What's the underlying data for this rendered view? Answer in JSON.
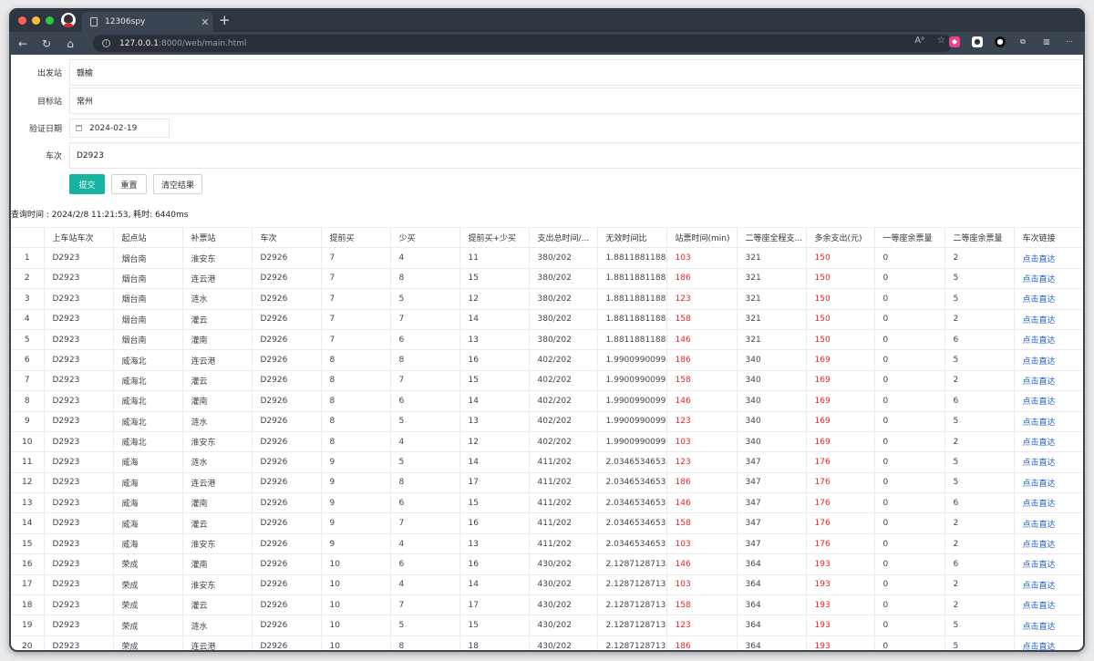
{
  "browser": {
    "tab_title": "12306spy",
    "url_host": "127.0.0.1",
    "url_path": ":8000/web/main.html"
  },
  "form": {
    "from_label": "出发站",
    "from_value": "赣榆",
    "to_label": "目标站",
    "to_value": "常州",
    "date_label": "验证日期",
    "date_value": "2024-02-19",
    "train_label": "车次",
    "train_value": "D2923",
    "submit_label": "提交",
    "reset_label": "重置",
    "clear_label": "清空结果"
  },
  "query_meta": "查询时间 : 2024/2/8 11:21:53, 耗时: 6440ms",
  "table": {
    "headers": [
      "",
      "上车站车次",
      "起点站",
      "补票站",
      "车次",
      "提前买",
      "少买",
      "提前买+少买",
      "支出总时间/...",
      "无效时间比",
      "站票时间(min)",
      "二等座全程支...",
      "多余支出(元)",
      "一等座余票量",
      "二等座余票量",
      "车次链接"
    ],
    "link_text": "点击直达",
    "rows": [
      [
        "1",
        "D2923",
        "烟台南",
        "淮安东",
        "D2926",
        "7",
        "4",
        "11",
        "380/202",
        "1.8811881188",
        "103",
        "321",
        "150",
        "0",
        "2"
      ],
      [
        "2",
        "D2923",
        "烟台南",
        "连云港",
        "D2926",
        "7",
        "8",
        "15",
        "380/202",
        "1.8811881188",
        "186",
        "321",
        "150",
        "0",
        "5"
      ],
      [
        "3",
        "D2923",
        "烟台南",
        "涟水",
        "D2926",
        "7",
        "5",
        "12",
        "380/202",
        "1.8811881188",
        "123",
        "321",
        "150",
        "0",
        "5"
      ],
      [
        "4",
        "D2923",
        "烟台南",
        "灌云",
        "D2926",
        "7",
        "7",
        "14",
        "380/202",
        "1.8811881188",
        "158",
        "321",
        "150",
        "0",
        "2"
      ],
      [
        "5",
        "D2923",
        "烟台南",
        "灌南",
        "D2926",
        "7",
        "6",
        "13",
        "380/202",
        "1.8811881188",
        "146",
        "321",
        "150",
        "0",
        "6"
      ],
      [
        "6",
        "D2923",
        "威海北",
        "连云港",
        "D2926",
        "8",
        "8",
        "16",
        "402/202",
        "1.9900990099",
        "186",
        "340",
        "169",
        "0",
        "5"
      ],
      [
        "7",
        "D2923",
        "威海北",
        "灌云",
        "D2926",
        "8",
        "7",
        "15",
        "402/202",
        "1.9900990099",
        "158",
        "340",
        "169",
        "0",
        "2"
      ],
      [
        "8",
        "D2923",
        "威海北",
        "灌南",
        "D2926",
        "8",
        "6",
        "14",
        "402/202",
        "1.9900990099",
        "146",
        "340",
        "169",
        "0",
        "6"
      ],
      [
        "9",
        "D2923",
        "威海北",
        "涟水",
        "D2926",
        "8",
        "5",
        "13",
        "402/202",
        "1.9900990099",
        "123",
        "340",
        "169",
        "0",
        "5"
      ],
      [
        "10",
        "D2923",
        "威海北",
        "淮安东",
        "D2926",
        "8",
        "4",
        "12",
        "402/202",
        "1.9900990099",
        "103",
        "340",
        "169",
        "0",
        "2"
      ],
      [
        "11",
        "D2923",
        "威海",
        "涟水",
        "D2926",
        "9",
        "5",
        "14",
        "411/202",
        "2.0346534653",
        "123",
        "347",
        "176",
        "0",
        "5"
      ],
      [
        "12",
        "D2923",
        "威海",
        "连云港",
        "D2926",
        "9",
        "8",
        "17",
        "411/202",
        "2.0346534653",
        "186",
        "347",
        "176",
        "0",
        "5"
      ],
      [
        "13",
        "D2923",
        "威海",
        "灌南",
        "D2926",
        "9",
        "6",
        "15",
        "411/202",
        "2.0346534653",
        "146",
        "347",
        "176",
        "0",
        "6"
      ],
      [
        "14",
        "D2923",
        "威海",
        "灌云",
        "D2926",
        "9",
        "7",
        "16",
        "411/202",
        "2.0346534653",
        "158",
        "347",
        "176",
        "0",
        "2"
      ],
      [
        "15",
        "D2923",
        "威海",
        "淮安东",
        "D2926",
        "9",
        "4",
        "13",
        "411/202",
        "2.0346534653",
        "103",
        "347",
        "176",
        "0",
        "2"
      ],
      [
        "16",
        "D2923",
        "荣成",
        "灌南",
        "D2926",
        "10",
        "6",
        "16",
        "430/202",
        "2.1287128713",
        "146",
        "364",
        "193",
        "0",
        "6"
      ],
      [
        "17",
        "D2923",
        "荣成",
        "淮安东",
        "D2926",
        "10",
        "4",
        "14",
        "430/202",
        "2.1287128713",
        "103",
        "364",
        "193",
        "0",
        "2"
      ],
      [
        "18",
        "D2923",
        "荣成",
        "灌云",
        "D2926",
        "10",
        "7",
        "17",
        "430/202",
        "2.1287128713",
        "158",
        "364",
        "193",
        "0",
        "2"
      ],
      [
        "19",
        "D2923",
        "荣成",
        "涟水",
        "D2926",
        "10",
        "5",
        "15",
        "430/202",
        "2.1287128713",
        "123",
        "364",
        "193",
        "0",
        "5"
      ],
      [
        "20",
        "D2923",
        "荣成",
        "连云港",
        "D2926",
        "10",
        "8",
        "18",
        "430/202",
        "2.1287128713",
        "186",
        "364",
        "193",
        "0",
        "5"
      ]
    ]
  },
  "colors": {
    "accent": "#16b3a0",
    "highlight_red": "#e22222",
    "link_blue": "#1e5bd6"
  }
}
